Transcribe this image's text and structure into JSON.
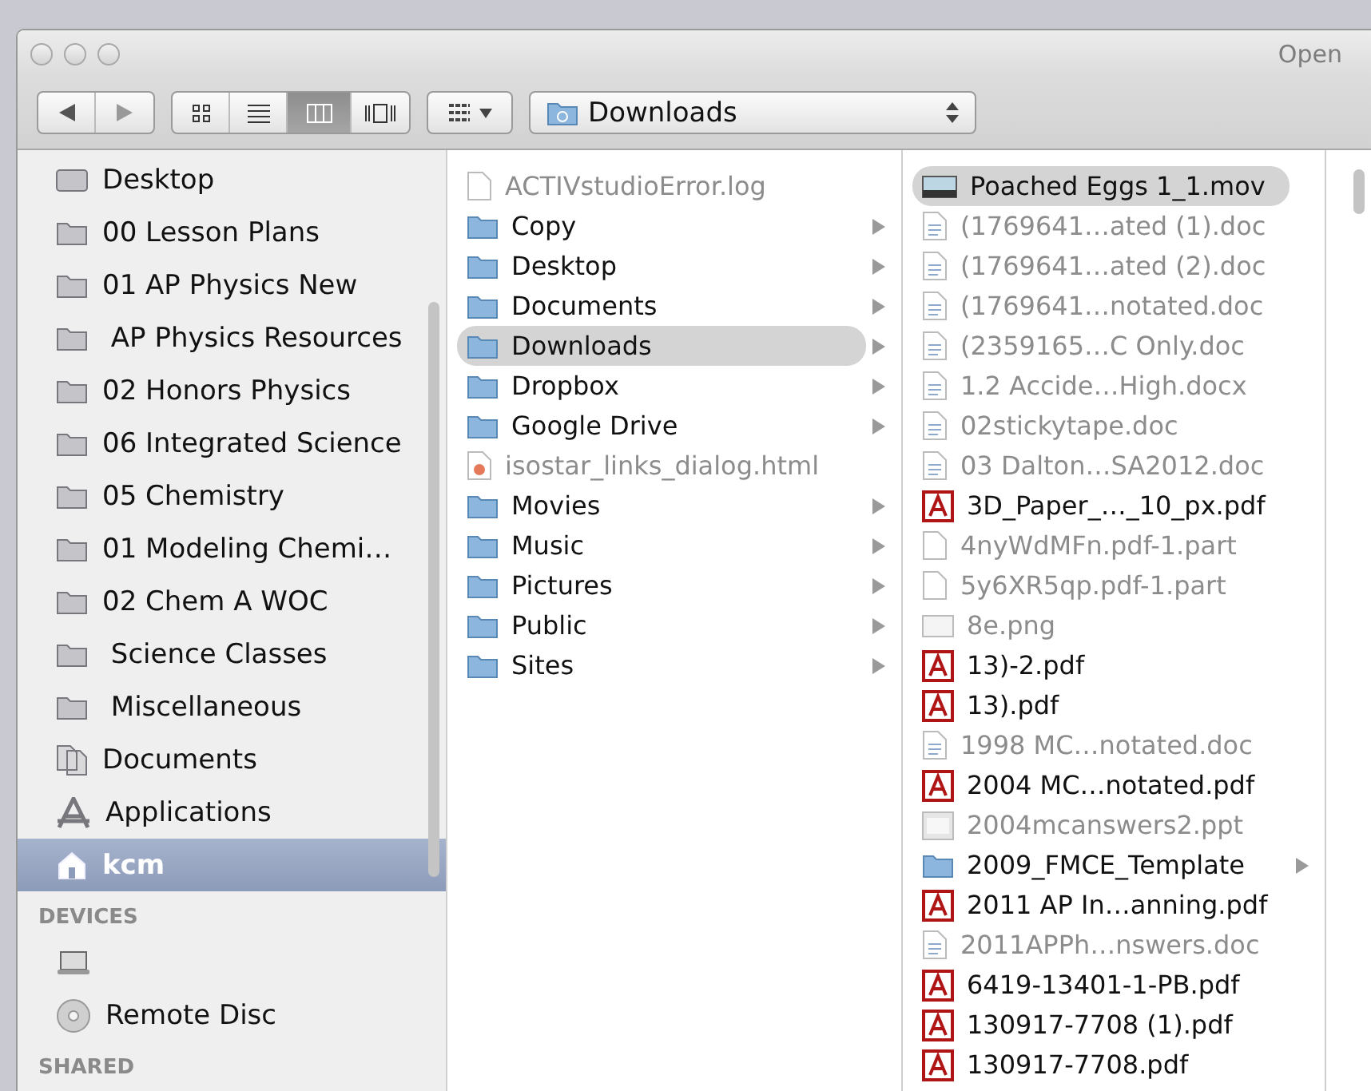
{
  "window": {
    "title": "Open"
  },
  "toolbar": {
    "views": [
      {
        "kind": "icon",
        "selected": false
      },
      {
        "kind": "list",
        "selected": false
      },
      {
        "kind": "column",
        "selected": true
      },
      {
        "kind": "coverflow",
        "selected": false
      }
    ],
    "location": "Downloads"
  },
  "sidebar": {
    "items": [
      {
        "label": "Desktop",
        "kind": "desktop",
        "selected": false
      },
      {
        "label": "00 Lesson Plans",
        "kind": "folder",
        "selected": false
      },
      {
        "label": "01 AP Physics New",
        "kind": "folder",
        "selected": false
      },
      {
        "label": " AP Physics Resources",
        "kind": "folder",
        "selected": false
      },
      {
        "label": "02 Honors Physics",
        "kind": "folder",
        "selected": false
      },
      {
        "label": "06 Integrated Science",
        "kind": "folder",
        "selected": false
      },
      {
        "label": "05 Chemistry",
        "kind": "folder",
        "selected": false
      },
      {
        "label": "01 Modeling Chemi…",
        "kind": "folder",
        "selected": false
      },
      {
        "label": "02 Chem A WOC",
        "kind": "folder",
        "selected": false
      },
      {
        "label": " Science Classes",
        "kind": "folder",
        "selected": false
      },
      {
        "label": " Miscellaneous",
        "kind": "folder",
        "selected": false
      },
      {
        "label": "Documents",
        "kind": "documents",
        "selected": false
      },
      {
        "label": "Applications",
        "kind": "applications",
        "selected": false
      },
      {
        "label": "kcm",
        "kind": "home",
        "selected": true
      }
    ],
    "sections": [
      {
        "heading": "DEVICES",
        "items": [
          {
            "kind": "computer"
          },
          {
            "label": "Remote Disc",
            "kind": "disc"
          }
        ]
      },
      {
        "heading": "SHARED"
      }
    ]
  },
  "columns": [
    {
      "items": [
        {
          "name": "ACTIVstudioError.log",
          "kind": "file",
          "dimmed": true,
          "has_children": false,
          "selected": false
        },
        {
          "name": "Copy",
          "kind": "folder",
          "dimmed": false,
          "has_children": true,
          "selected": false
        },
        {
          "name": "Desktop",
          "kind": "folder",
          "dimmed": false,
          "has_children": true,
          "selected": false
        },
        {
          "name": "Documents",
          "kind": "folder",
          "dimmed": false,
          "has_children": true,
          "selected": false
        },
        {
          "name": "Downloads",
          "kind": "folder",
          "dimmed": false,
          "has_children": true,
          "selected": true
        },
        {
          "name": "Dropbox",
          "kind": "folder",
          "dimmed": false,
          "has_children": true,
          "selected": false
        },
        {
          "name": "Google Drive",
          "kind": "folder",
          "dimmed": false,
          "has_children": true,
          "selected": false
        },
        {
          "name": "isostar_links_dialog.html",
          "kind": "html",
          "dimmed": true,
          "has_children": false,
          "selected": false
        },
        {
          "name": "Movies",
          "kind": "folder",
          "dimmed": false,
          "has_children": true,
          "selected": false
        },
        {
          "name": "Music",
          "kind": "folder",
          "dimmed": false,
          "has_children": true,
          "selected": false
        },
        {
          "name": "Pictures",
          "kind": "folder",
          "dimmed": false,
          "has_children": true,
          "selected": false
        },
        {
          "name": "Public",
          "kind": "folder",
          "dimmed": false,
          "has_children": true,
          "selected": false
        },
        {
          "name": "Sites",
          "kind": "folder",
          "dimmed": false,
          "has_children": true,
          "selected": false
        }
      ]
    },
    {
      "items": [
        {
          "name": "Poached Eggs 1_1.mov",
          "kind": "movie",
          "dimmed": false,
          "has_children": false,
          "selected": true
        },
        {
          "name": "(1769641…ated (1).doc",
          "kind": "doc",
          "dimmed": true,
          "has_children": false,
          "selected": false
        },
        {
          "name": "(1769641…ated (2).doc",
          "kind": "doc",
          "dimmed": true,
          "has_children": false,
          "selected": false
        },
        {
          "name": "(1769641…notated.doc",
          "kind": "doc",
          "dimmed": true,
          "has_children": false,
          "selected": false
        },
        {
          "name": "(2359165…C Only.doc",
          "kind": "doc",
          "dimmed": true,
          "has_children": false,
          "selected": false
        },
        {
          "name": "1.2 Accide…High.docx",
          "kind": "doc",
          "dimmed": true,
          "has_children": false,
          "selected": false
        },
        {
          "name": "02stickytape.doc",
          "kind": "doc",
          "dimmed": true,
          "has_children": false,
          "selected": false
        },
        {
          "name": "03 Dalton…SA2012.doc",
          "kind": "doc",
          "dimmed": true,
          "has_children": false,
          "selected": false
        },
        {
          "name": "3D_Paper_…_10_px.pdf",
          "kind": "pdf",
          "dimmed": false,
          "has_children": false,
          "selected": false
        },
        {
          "name": "4nyWdMFn.pdf-1.part",
          "kind": "file",
          "dimmed": true,
          "has_children": false,
          "selected": false
        },
        {
          "name": "5y6XR5qp.pdf-1.part",
          "kind": "file",
          "dimmed": true,
          "has_children": false,
          "selected": false
        },
        {
          "name": "8e.png",
          "kind": "image",
          "dimmed": true,
          "has_children": false,
          "selected": false
        },
        {
          "name": "13)-2.pdf",
          "kind": "pdf",
          "dimmed": false,
          "has_children": false,
          "selected": false
        },
        {
          "name": "13).pdf",
          "kind": "pdf",
          "dimmed": false,
          "has_children": false,
          "selected": false
        },
        {
          "name": "1998 MC…notated.doc",
          "kind": "doc",
          "dimmed": true,
          "has_children": false,
          "selected": false
        },
        {
          "name": "2004 MC…notated.pdf",
          "kind": "pdf",
          "dimmed": false,
          "has_children": false,
          "selected": false
        },
        {
          "name": "2004mcanswers2.ppt",
          "kind": "slides",
          "dimmed": true,
          "has_children": false,
          "selected": false
        },
        {
          "name": "2009_FMCE_Template",
          "kind": "plainfolder",
          "dimmed": false,
          "has_children": true,
          "selected": false
        },
        {
          "name": "2011 AP In…anning.pdf",
          "kind": "pdf",
          "dimmed": false,
          "has_children": false,
          "selected": false
        },
        {
          "name": "2011APPh…nswers.doc",
          "kind": "doc",
          "dimmed": true,
          "has_children": false,
          "selected": false
        },
        {
          "name": "6419-13401-1-PB.pdf",
          "kind": "pdf",
          "dimmed": false,
          "has_children": false,
          "selected": false
        },
        {
          "name": "130917-7708 (1).pdf",
          "kind": "pdf",
          "dimmed": false,
          "has_children": false,
          "selected": false
        },
        {
          "name": "130917-7708.pdf",
          "kind": "pdf",
          "dimmed": false,
          "has_children": false,
          "selected": false
        }
      ]
    }
  ]
}
